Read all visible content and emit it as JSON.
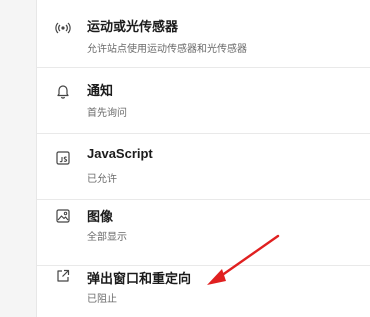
{
  "settings": [
    {
      "icon": "sensors-icon",
      "title": "运动或光传感器",
      "subtitle": "允许站点使用运动传感器和光传感器"
    },
    {
      "icon": "bell-icon",
      "title": "通知",
      "subtitle": "首先询问"
    },
    {
      "icon": "javascript-icon",
      "title": "JavaScript",
      "subtitle": "已允许"
    },
    {
      "icon": "image-icon",
      "title": "图像",
      "subtitle": "全部显示"
    },
    {
      "icon": "external-link-icon",
      "title": "弹出窗口和重定向",
      "subtitle": "已阻止"
    }
  ],
  "colors": {
    "annotation_arrow": "#e02020"
  }
}
